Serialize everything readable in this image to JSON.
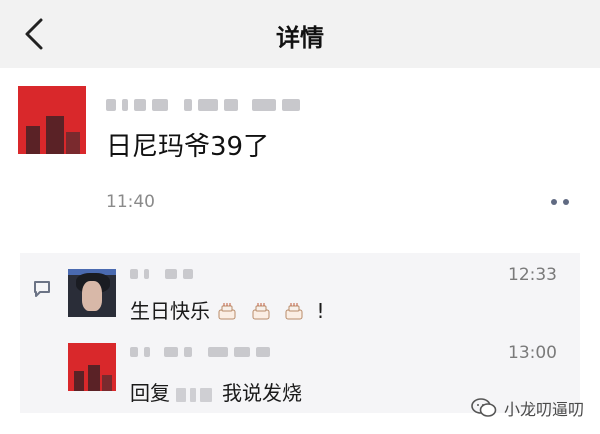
{
  "header": {
    "title": "详情"
  },
  "post": {
    "text": "日尼玛爷39了",
    "time": "11:40"
  },
  "comments": [
    {
      "time": "12:33",
      "text": "生日快乐",
      "suffix": "!"
    },
    {
      "time": "13:00",
      "reply_prefix": "回复",
      "text": "我说发烧"
    }
  ],
  "watermark": {
    "text": "小龙叨逼叨"
  },
  "icons": [
    "back-chevron-icon",
    "more-dots-icon",
    "comment-icon",
    "cake-icon",
    "wechat-logo-icon"
  ],
  "colors": {
    "header_bg": "#f2f2f2",
    "avatar_red": "#d9282b",
    "comment_bg": "#f5f5f7"
  }
}
